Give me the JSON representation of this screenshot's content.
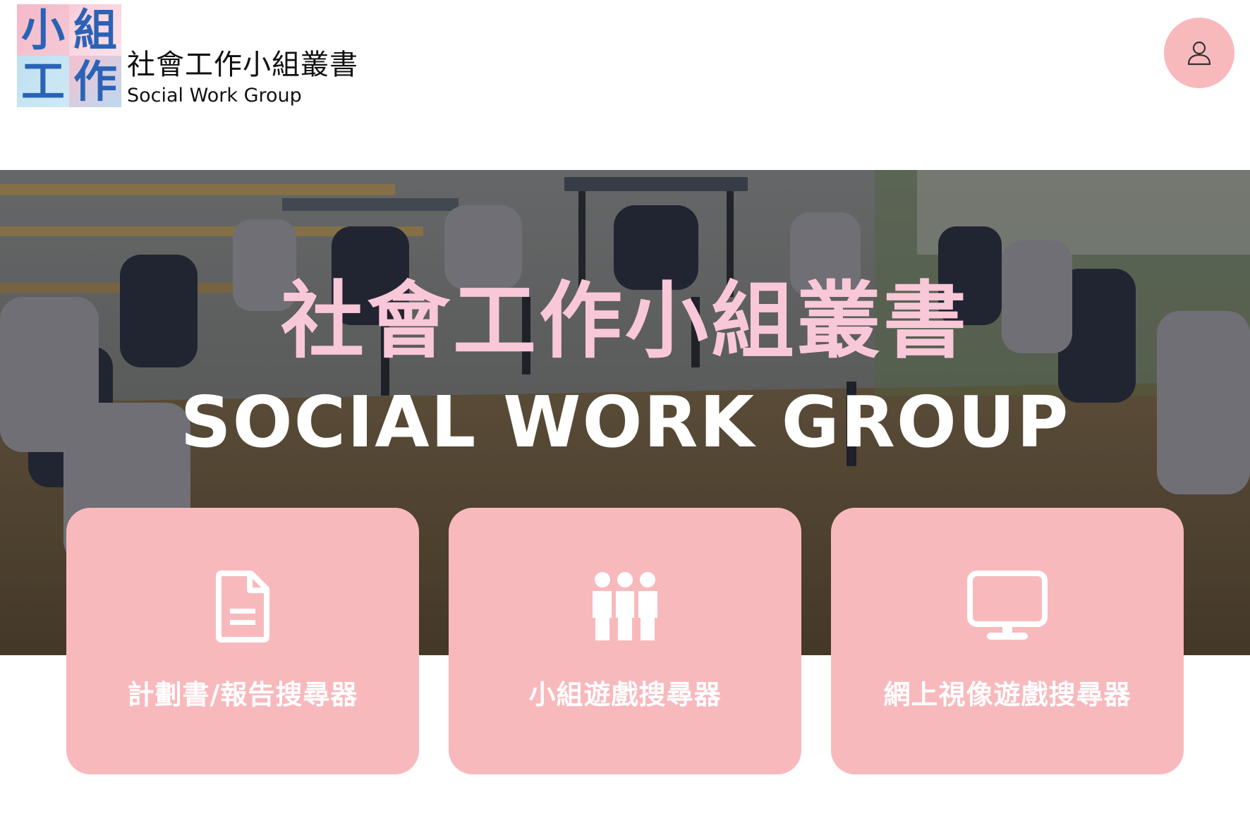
{
  "header": {
    "logo_mark": [
      "小",
      "組",
      "工",
      "作"
    ],
    "logo_title_zh": "社會工作小組叢書",
    "logo_title_en": "Social Work Group",
    "user_button_icon": "user-icon"
  },
  "hero": {
    "title_zh": "社會工作小組叢書",
    "title_en": "SOCIAL WORK GROUP"
  },
  "cards": [
    {
      "label": "計劃書/報告搜尋器",
      "icon": "document-icon"
    },
    {
      "label": "小組遊戲搜尋器",
      "icon": "people-group-icon"
    },
    {
      "label": "網上視像遊戲搜尋器",
      "icon": "monitor-icon"
    }
  ],
  "colors": {
    "accent_pink": "#f8b9bd",
    "hero_title_pink": "#f9c8d8",
    "logo_blue": "#2a63b6",
    "card_text": "#ffffff"
  }
}
